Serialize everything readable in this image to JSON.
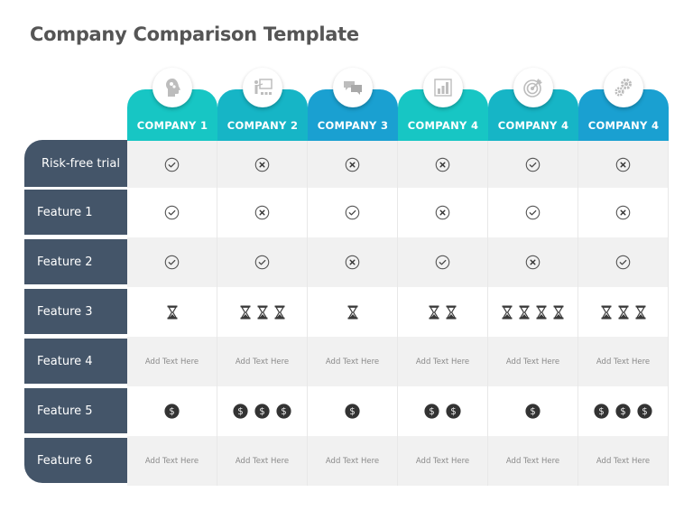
{
  "title": "Company Comparison Template",
  "colors": {
    "label_bg": "#445569",
    "tab_teal": "#17c3c3",
    "tab_teal_dark": "#15b3c2",
    "tab_blue": "#1a9fcf",
    "cell_gray": "#f1f1f1",
    "icon_dark": "#333333"
  },
  "companies": [
    {
      "label": "COMPANY 1",
      "icon": "head-gears-icon",
      "color": "#17c6c4"
    },
    {
      "label": "COMPANY 2",
      "icon": "presentation-board-icon",
      "color": "#16b5c6"
    },
    {
      "label": "COMPANY 3",
      "icon": "chat-bubbles-icon",
      "color": "#1aa0d1"
    },
    {
      "label": "COMPANY 4",
      "icon": "bar-chart-icon",
      "color": "#17c6c4"
    },
    {
      "label": "COMPANY 4",
      "icon": "target-icon",
      "color": "#16b5c6"
    },
    {
      "label": "COMPANY 4",
      "icon": "gears-icon",
      "color": "#1aa0d1"
    }
  ],
  "rows": [
    {
      "label": "Risk-free trial",
      "type": "check",
      "values": [
        "check",
        "cross",
        "cross",
        "cross",
        "check",
        "cross"
      ]
    },
    {
      "label": "Feature 1",
      "type": "check",
      "values": [
        "check",
        "cross",
        "check",
        "cross",
        "check",
        "cross"
      ]
    },
    {
      "label": "Feature 2",
      "type": "check",
      "values": [
        "check",
        "check",
        "cross",
        "check",
        "cross",
        "check"
      ]
    },
    {
      "label": "Feature 3",
      "type": "hourglass",
      "values": [
        1,
        3,
        1,
        2,
        4,
        3
      ]
    },
    {
      "label": "Feature 4",
      "type": "text",
      "values": [
        "Add Text Here",
        "Add Text Here",
        "Add Text Here",
        "Add Text Here",
        "Add Text Here",
        "Add Text Here"
      ]
    },
    {
      "label": "Feature 5",
      "type": "dollar",
      "values": [
        1,
        3,
        1,
        2,
        1,
        3
      ]
    },
    {
      "label": "Feature 6",
      "type": "text",
      "values": [
        "Add Text Here",
        "Add Text Here",
        "Add Text Here",
        "Add Text Here",
        "Add Text Here",
        "Add Text Here"
      ]
    }
  ]
}
